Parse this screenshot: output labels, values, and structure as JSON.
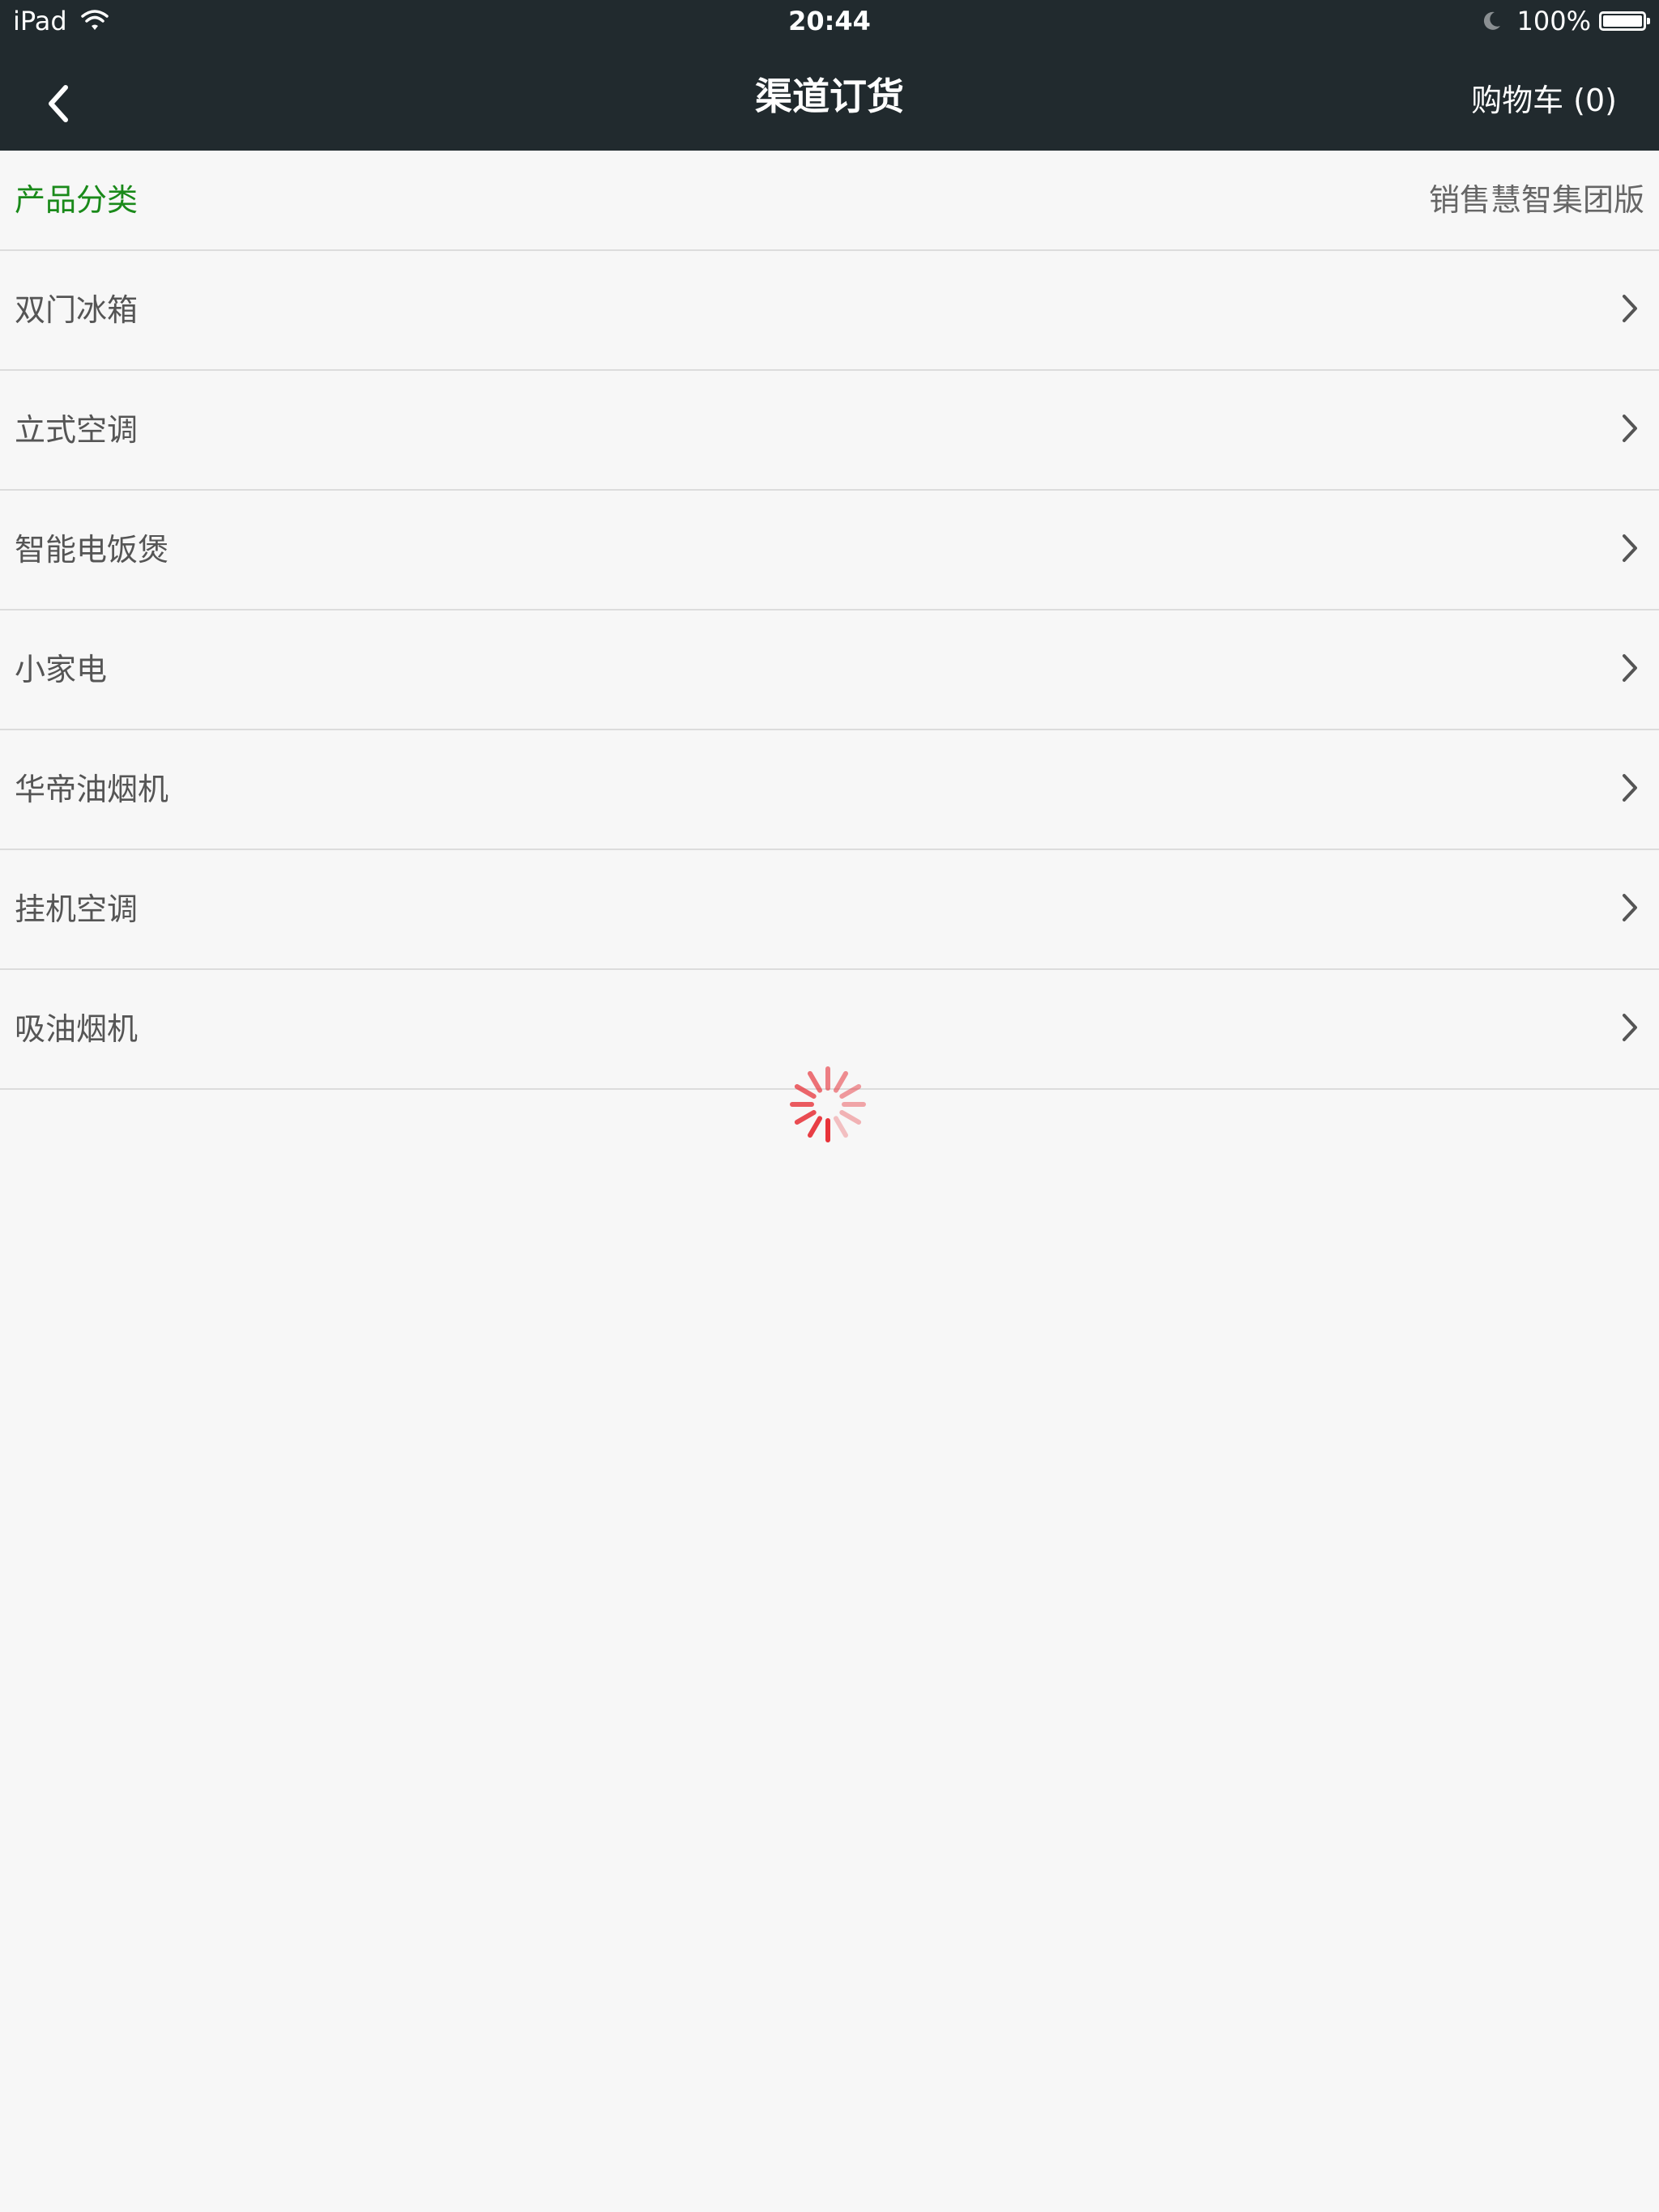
{
  "status_bar": {
    "device": "iPad",
    "time": "20:44",
    "battery": "100%",
    "wifi_icon": "wifi-icon",
    "moon_icon": "moon-icon",
    "battery_icon": "battery-icon"
  },
  "nav": {
    "back_icon": "chevron-left-icon",
    "title": "渠道订货",
    "cart_label": "购物车 (0)"
  },
  "category_header": {
    "left": "产品分类",
    "right": "销售慧智集团版",
    "left_color": "#1a8a1a"
  },
  "categories": [
    {
      "label": "双门冰箱"
    },
    {
      "label": "立式空调"
    },
    {
      "label": "智能电饭煲"
    },
    {
      "label": "小家电"
    },
    {
      "label": "华帝油烟机"
    },
    {
      "label": "挂机空调"
    },
    {
      "label": "吸油烟机"
    }
  ],
  "loading_indicator": {
    "icon": "spinner-icon",
    "color": "#e8333a"
  },
  "colors": {
    "nav_background": "#212a2e",
    "page_background": "#f7f7f7",
    "divider": "#dcdcdc"
  }
}
